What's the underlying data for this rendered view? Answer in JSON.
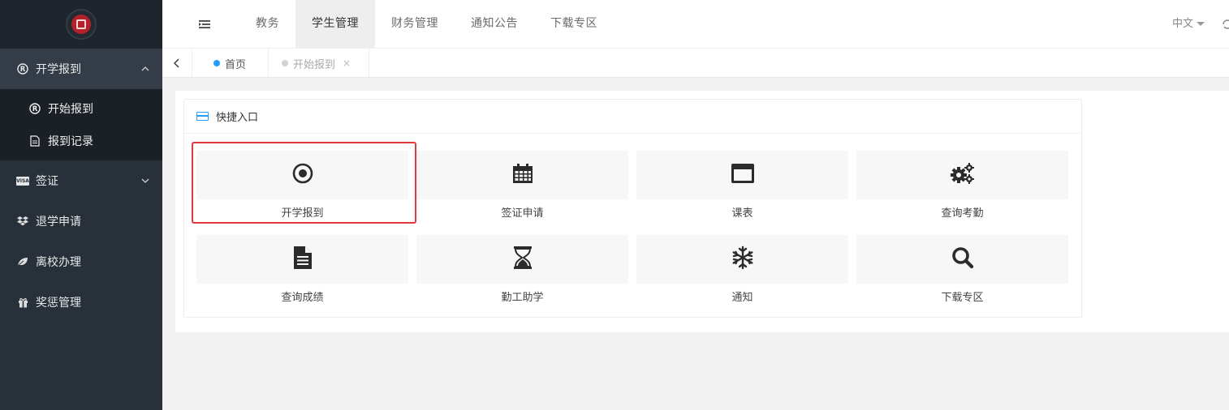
{
  "sidebar": {
    "items": [
      {
        "label": "开学报到",
        "icon": "registered-icon",
        "expanded": true,
        "children": [
          {
            "label": "开始报到",
            "icon": "registered-icon"
          },
          {
            "label": "报到记录",
            "icon": "file-text-icon"
          }
        ]
      },
      {
        "label": "签证",
        "icon": "visa-icon",
        "expanded": false
      },
      {
        "label": "退学申请",
        "icon": "dropbox-icon"
      },
      {
        "label": "离校办理",
        "icon": "leaf-icon"
      },
      {
        "label": "奖惩管理",
        "icon": "gift-icon"
      }
    ],
    "visa_badge": "VISA"
  },
  "header": {
    "tabs": [
      "教务",
      "学生管理",
      "财务管理",
      "通知公告",
      "下载专区"
    ],
    "active_tab": "学生管理",
    "language": "中文"
  },
  "tabbar": {
    "tabs": [
      {
        "label": "首页",
        "dot_color": "#1e9fff"
      },
      {
        "label": "开始报到",
        "dot_color": "#d2d2d2",
        "closable": true
      }
    ],
    "close_symbol": "×"
  },
  "quick_access": {
    "title": "快捷入口",
    "tiles": [
      {
        "label": "开学报到",
        "icon": "dot-circle-icon"
      },
      {
        "label": "签证申请",
        "icon": "calendar-icon"
      },
      {
        "label": "课表",
        "icon": "window-icon"
      },
      {
        "label": "查询考勤",
        "icon": "cogs-icon"
      },
      {
        "label": "查询成绩",
        "icon": "document-icon"
      },
      {
        "label": "勤工助学",
        "icon": "hourglass-icon"
      },
      {
        "label": "通知",
        "icon": "snowflake-icon"
      },
      {
        "label": "下载专区",
        "icon": "search-icon"
      }
    ]
  },
  "colors": {
    "sidebar_bg": "#28303a",
    "accent": "#1e9fff",
    "highlight": "#e4393c"
  }
}
